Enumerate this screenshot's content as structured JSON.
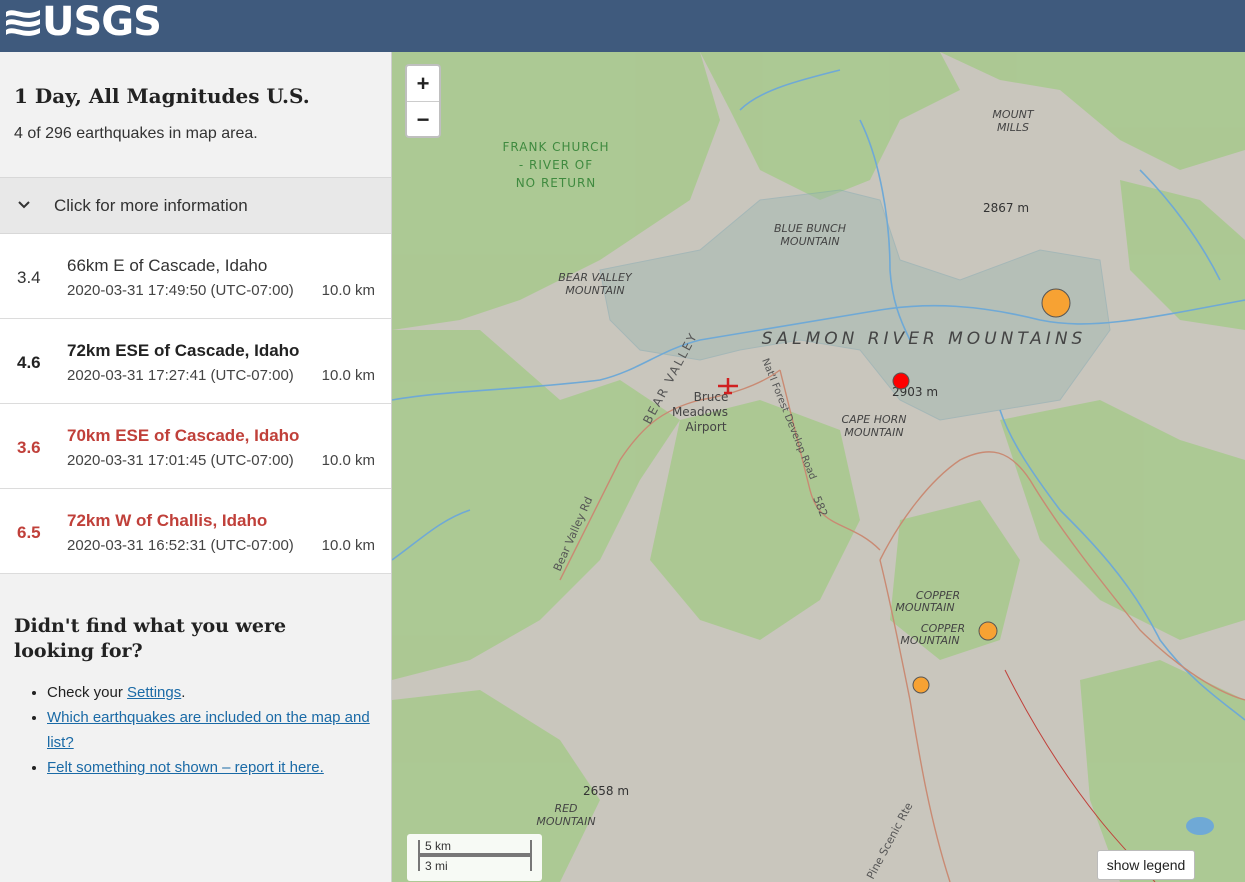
{
  "header": {
    "logo_text": "USGS"
  },
  "panel": {
    "title": "1 Day, All Magnitudes U.S.",
    "count_text": "4 of 296 earthquakes in map area.",
    "more_info_label": "Click for more information"
  },
  "earthquakes": [
    {
      "mag": "3.4",
      "place": "66km E of Cascade, Idaho",
      "time": "2020-03-31 17:49:50 (UTC-07:00)",
      "depth": "10.0 km",
      "style": "normal"
    },
    {
      "mag": "4.6",
      "place": "72km ESE of Cascade, Idaho",
      "time": "2020-03-31 17:27:41 (UTC-07:00)",
      "depth": "10.0 km",
      "style": "bold"
    },
    {
      "mag": "3.6",
      "place": "70km ESE of Cascade, Idaho",
      "time": "2020-03-31 17:01:45 (UTC-07:00)",
      "depth": "10.0 km",
      "style": "significant"
    },
    {
      "mag": "6.5",
      "place": "72km W of Challis, Idaho",
      "time": "2020-03-31 16:52:31 (UTC-07:00)",
      "depth": "10.0 km",
      "style": "significant"
    }
  ],
  "help": {
    "title": "Didn't find what you were looking for?",
    "item1_prefix": "Check your ",
    "item1_link": "Settings",
    "item1_suffix": ".",
    "item2_link": "Which earthquakes are included on the map and list?",
    "item3_link": "Felt something not shown – report it here."
  },
  "map": {
    "zoom_in": "+",
    "zoom_out": "−",
    "scale_km": "5 km",
    "scale_mi": "3 mi",
    "legend_button": "show legend",
    "labels": {
      "frank_church_1": "FRANK CHURCH",
      "frank_church_2": "- RIVER OF",
      "frank_church_3": "NO RETURN",
      "mount_mills_1": "MOUNT",
      "mount_mills_2": "MILLS",
      "elev_2867": "2867 m",
      "blue_bunch_1": "BLUE BUNCH",
      "blue_bunch_2": "MOUNTAIN",
      "bear_valley_mtn_1": "BEAR VALLEY",
      "bear_valley_mtn_2": "MOUNTAIN",
      "salmon_river": "SALMON RIVER MOUNTAINS",
      "bear_valley": "BEAR VALLEY",
      "nat_forest_road": "Nat'l Forest Develop Road",
      "road_582": "582",
      "bruce_1": "Bruce",
      "bruce_2": "Meadows",
      "bruce_3": "Airport",
      "elev_2903": "2903 m",
      "cape_horn_1": "CAPE HORN",
      "cape_horn_2": "MOUNTAIN",
      "bear_valley_rd": "Bear Valley Rd",
      "copper_1a": "COPPER",
      "copper_1b": "MOUNTAIN",
      "copper_2a": "COPPER",
      "copper_2b": "MOUNTAIN",
      "elev_2658": "2658 m",
      "red_mtn_1": "RED",
      "red_mtn_2": "MOUNTAIN",
      "pine_scenic": "Pine Scenic Rte"
    },
    "markers": [
      {
        "id": "m6.5",
        "color": "#f7a233"
      },
      {
        "id": "m4.6",
        "color": "#ff0000"
      },
      {
        "id": "m3.6",
        "color": "#f7a233"
      },
      {
        "id": "m3.4",
        "color": "#f7a233"
      }
    ],
    "colors": {
      "forest": "#a9c98f",
      "terrain": "#c9c6bd",
      "water": "#6fa9d6",
      "road": "#c98a73"
    }
  }
}
